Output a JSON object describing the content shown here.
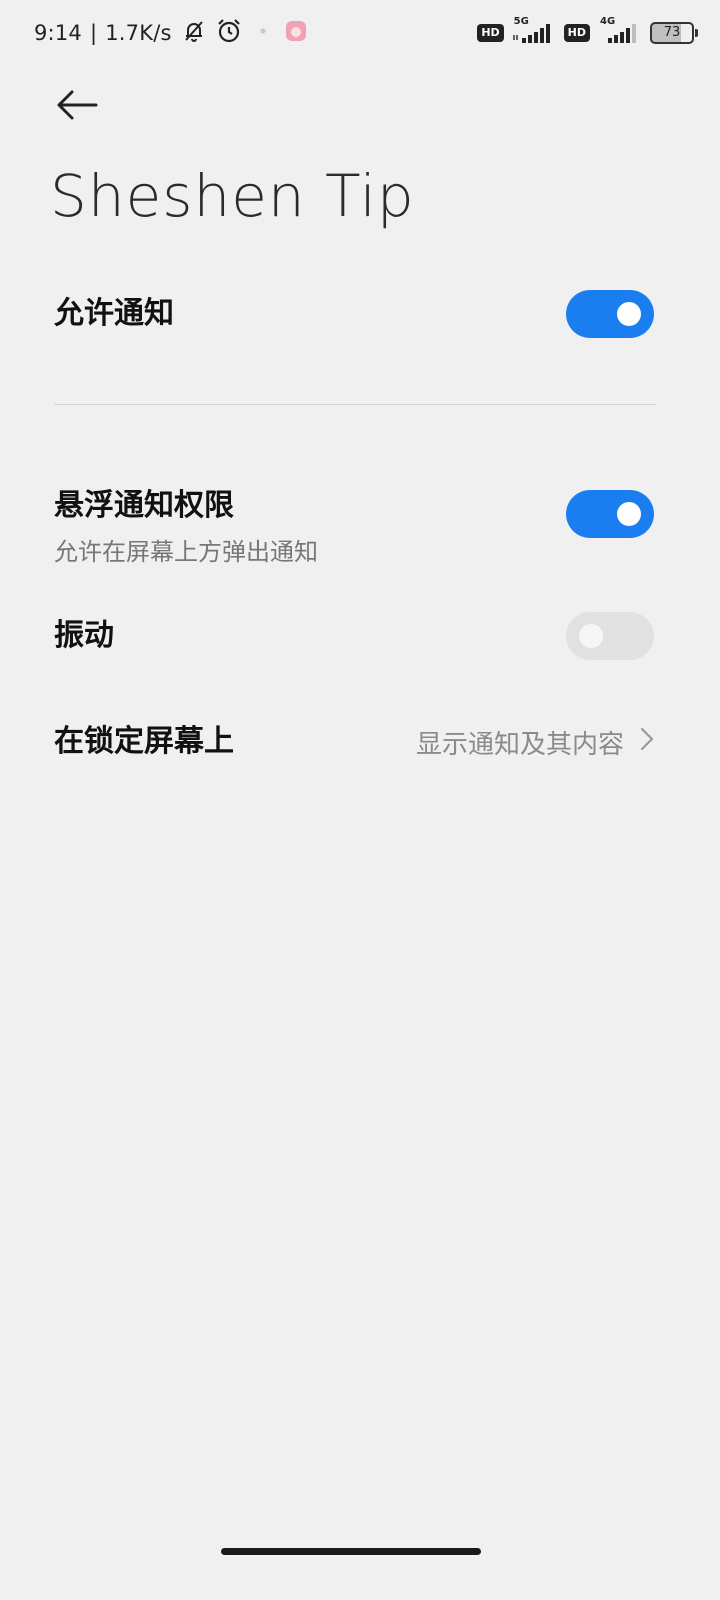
{
  "status_bar": {
    "time": "9:14",
    "separator": "|",
    "net_speed": "1.7K/s",
    "icons": [
      "silent-bell-icon",
      "alarm-icon",
      "app-notification-icon",
      "app-notification-icon"
    ],
    "sim1": {
      "hd": "HD",
      "type": "5G"
    },
    "sim2": {
      "hd": "HD",
      "type": "4G"
    },
    "battery": "73"
  },
  "header": {
    "back_icon": "back-arrow-icon",
    "title": "Sheshen Tip"
  },
  "settings": {
    "allow_notifications": {
      "label": "允许通知",
      "enabled": true
    },
    "floating_notifications": {
      "label": "悬浮通知权限",
      "description": "允许在屏幕上方弹出通知",
      "enabled": true
    },
    "vibration": {
      "label": "振动",
      "enabled": false
    },
    "lock_screen": {
      "label": "在锁定屏幕上",
      "value": "显示通知及其内容"
    }
  },
  "colors": {
    "accent": "#1a7ef0",
    "background": "#f0f0f0",
    "toggle_off": "#e1e1e1"
  }
}
